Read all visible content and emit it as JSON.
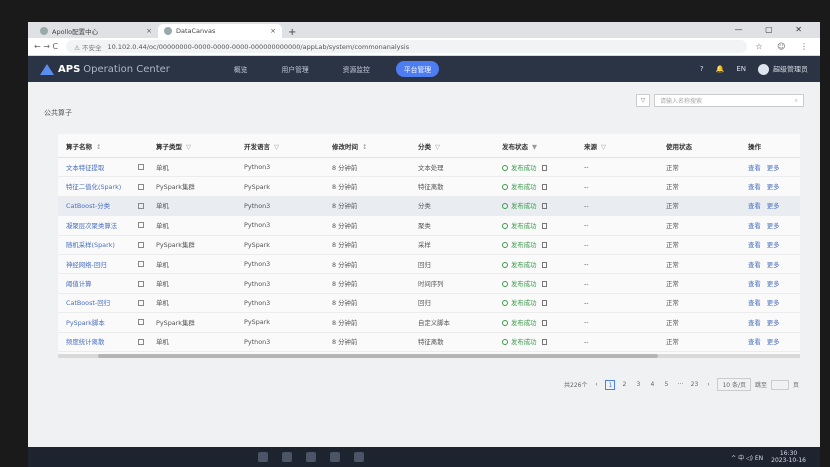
{
  "browser": {
    "tabs": [
      {
        "title": "Apollo配置中心",
        "close": "×"
      },
      {
        "title": "DataCanvas",
        "close": "×"
      }
    ],
    "new_tab": "+",
    "window_controls": "— ▢ ✕",
    "nav_icons": "← → C",
    "secure_label": "⚠ 不安全",
    "url": "10.102.0.44/oc/00000000-0000-0000-0000-000000000000/appLab/system/commonanalysis",
    "addr_icons": "☆ ☺ ⋮"
  },
  "app": {
    "logo_text": "APS",
    "logo_sub": "Operation Center",
    "menu": [
      "概览",
      "用户管理",
      "资源监控",
      "平台管理"
    ],
    "active_menu": 3,
    "lang": "EN",
    "user": "超级管理员",
    "help_icon": "?",
    "bell_icon": "🔔"
  },
  "page": {
    "breadcrumb": "公共算子",
    "filter_icon": "▽",
    "search_placeholder": "请输入名称搜索",
    "search_icon": "⌕"
  },
  "table": {
    "columns": [
      {
        "label": "算子名称",
        "sorter": "↕"
      },
      {
        "label": "算子类型",
        "sorter": "▽"
      },
      {
        "label": "开发语言",
        "sorter": "▽"
      },
      {
        "label": "修改时间",
        "sorter": "↕"
      },
      {
        "label": "分类",
        "sorter": "▽"
      },
      {
        "label": "发布状态",
        "sorter": "▼"
      },
      {
        "label": "来源",
        "sorter": "▽"
      },
      {
        "label": "使用状态",
        "sorter": ""
      },
      {
        "label": "操作",
        "sorter": ""
      }
    ],
    "rows": [
      {
        "name": "文本特征提取",
        "type": "单机",
        "lang": "Python3",
        "time": "8 分钟前",
        "category": "文本处理",
        "status": "发布成功",
        "source": "--",
        "usage": "正常"
      },
      {
        "name": "特征二值化(Spark)",
        "type": "PySpark集群",
        "lang": "PySpark",
        "time": "8 分钟前",
        "category": "特征离散",
        "status": "发布成功",
        "source": "--",
        "usage": "正常"
      },
      {
        "name": "CatBoost-分类",
        "type": "单机",
        "lang": "Python3",
        "time": "8 分钟前",
        "category": "分类",
        "status": "发布成功",
        "source": "--",
        "usage": "正常"
      },
      {
        "name": "凝聚层次聚类算法",
        "type": "单机",
        "lang": "Python3",
        "time": "8 分钟前",
        "category": "聚类",
        "status": "发布成功",
        "source": "--",
        "usage": "正常"
      },
      {
        "name": "随机采样(Spark)",
        "type": "PySpark集群",
        "lang": "PySpark",
        "time": "8 分钟前",
        "category": "采样",
        "status": "发布成功",
        "source": "--",
        "usage": "正常"
      },
      {
        "name": "神经网络-回归",
        "type": "单机",
        "lang": "Python3",
        "time": "8 分钟前",
        "category": "回归",
        "status": "发布成功",
        "source": "--",
        "usage": "正常"
      },
      {
        "name": "阈值计算",
        "type": "单机",
        "lang": "Python3",
        "time": "8 分钟前",
        "category": "时间序列",
        "status": "发布成功",
        "source": "--",
        "usage": "正常"
      },
      {
        "name": "CatBoost-回归",
        "type": "单机",
        "lang": "Python3",
        "time": "8 分钟前",
        "category": "回归",
        "status": "发布成功",
        "source": "--",
        "usage": "正常"
      },
      {
        "name": "PySpark脚本",
        "type": "PySpark集群",
        "lang": "PySpark",
        "time": "8 分钟前",
        "category": "自定义脚本",
        "status": "发布成功",
        "source": "--",
        "usage": "正常"
      },
      {
        "name": "频度统计离散",
        "type": "单机",
        "lang": "Python3",
        "time": "8 分钟前",
        "category": "特征离散",
        "status": "发布成功",
        "source": "--",
        "usage": "正常"
      }
    ],
    "action_view": "查看",
    "action_more": "更多"
  },
  "pagination": {
    "total": "共226个",
    "prev": "‹",
    "pages": [
      "1",
      "2",
      "3",
      "4",
      "5",
      "···",
      "23"
    ],
    "next": "›",
    "page_size": "10 条/页",
    "jump_label": "跳至",
    "jump_suffix": "页"
  },
  "taskbar": {
    "tray": "^ 中 ◁) EN",
    "time": "16:30",
    "date": "2023-10-16"
  }
}
